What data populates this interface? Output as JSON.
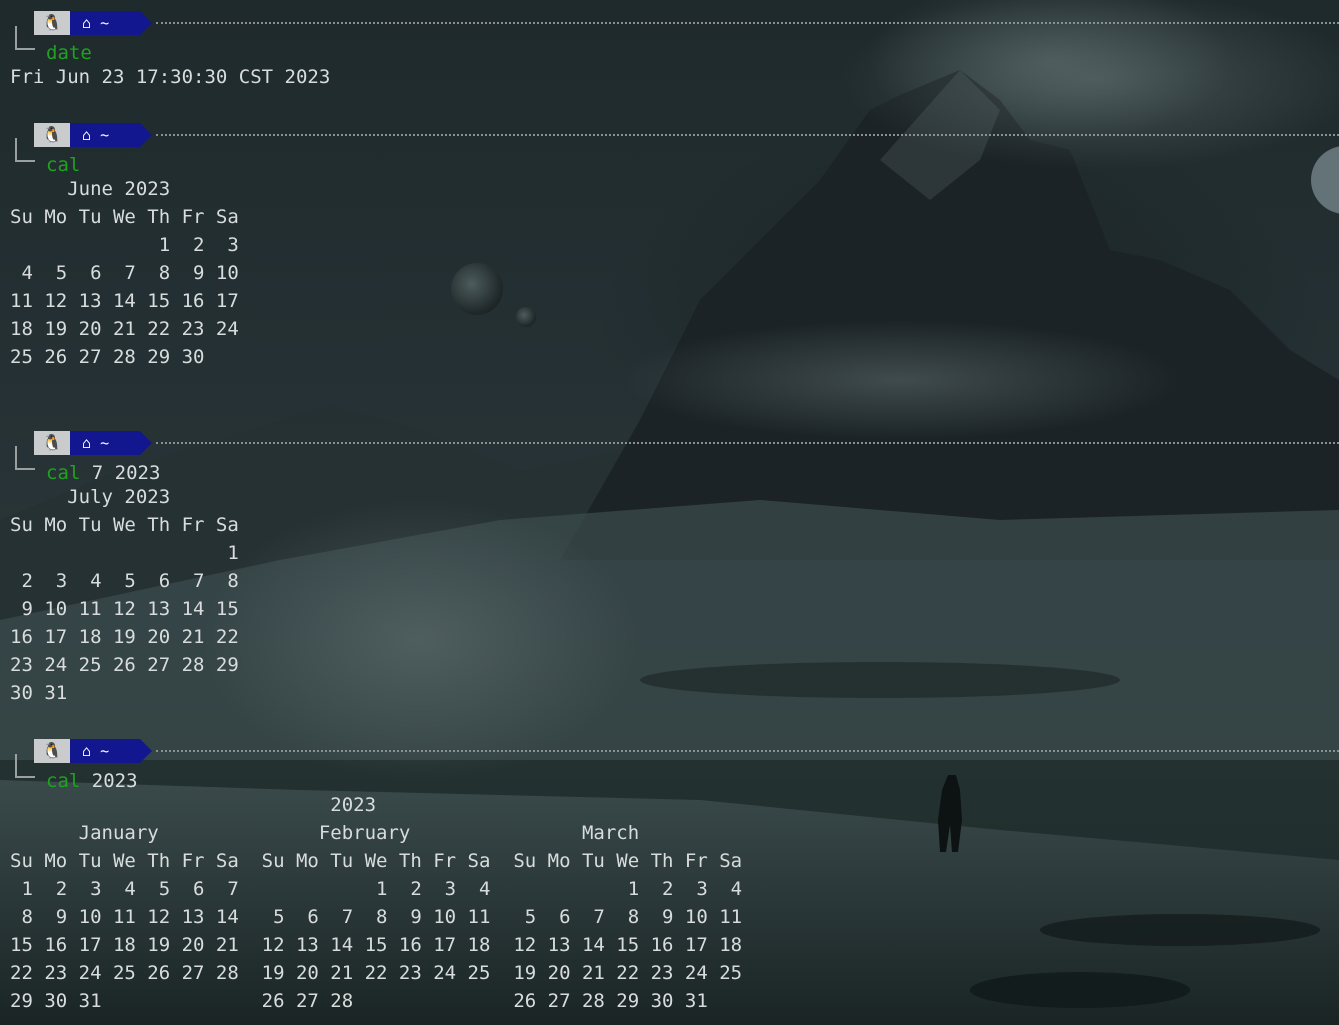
{
  "prompt": {
    "os_icon": "tux-penguin-icon",
    "home_icon": "home-icon",
    "dir": "~"
  },
  "blocks": [
    {
      "cmd": "date",
      "args": "",
      "output": "Fri Jun 23 17:30:30 CST 2023"
    },
    {
      "cmd": "cal",
      "args": "",
      "output": "     June 2023\nSu Mo Tu We Th Fr Sa\n             1  2  3\n 4  5  6  7  8  9 10\n11 12 13 14 15 16 17\n18 19 20 21 22 23 24\n25 26 27 28 29 30"
    },
    {
      "cmd": "cal",
      "args": " 7 2023",
      "output": "     July 2023\nSu Mo Tu We Th Fr Sa\n                   1\n 2  3  4  5  6  7  8\n 9 10 11 12 13 14 15\n16 17 18 19 20 21 22\n23 24 25 26 27 28 29\n30 31"
    },
    {
      "cmd": "cal",
      "args": " 2023",
      "output": "                            2023\n      January              February               March\nSu Mo Tu We Th Fr Sa  Su Mo Tu We Th Fr Sa  Su Mo Tu We Th Fr Sa\n 1  2  3  4  5  6  7            1  2  3  4            1  2  3  4\n 8  9 10 11 12 13 14   5  6  7  8  9 10 11   5  6  7  8  9 10 11\n15 16 17 18 19 20 21  12 13 14 15 16 17 18  12 13 14 15 16 17 18\n22 23 24 25 26 27 28  19 20 21 22 23 24 25  19 20 21 22 23 24 25\n29 30 31              26 27 28              26 27 28 29 30 31"
    }
  ]
}
